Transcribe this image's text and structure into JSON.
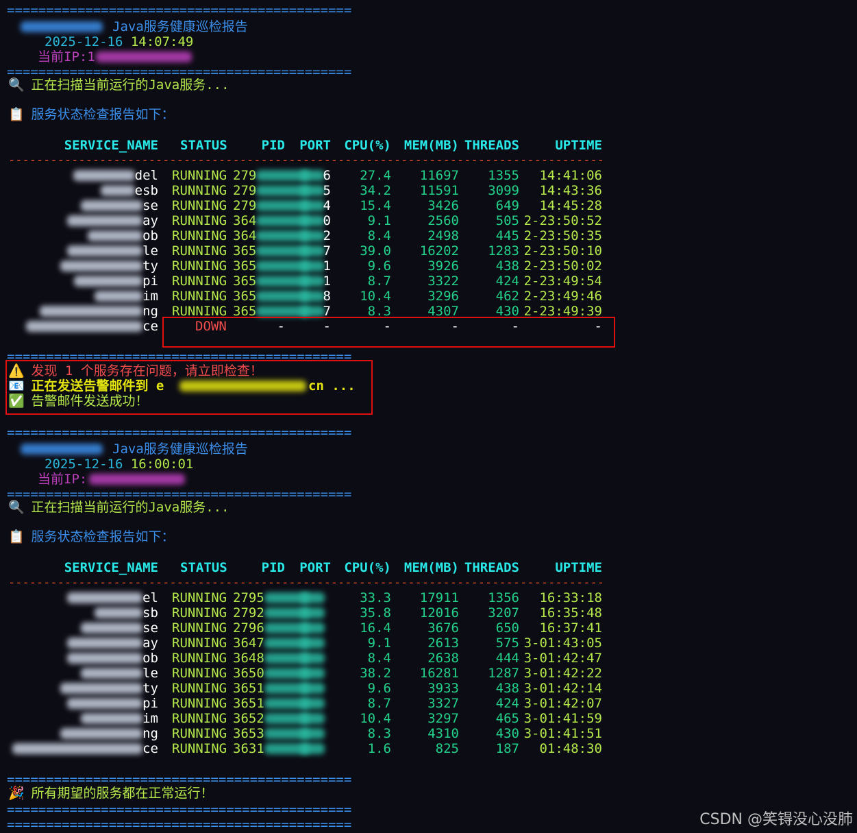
{
  "separator": "============================================",
  "dashes": "-------------------------------------------------------------------------------------------------",
  "report1": {
    "title": "Java服务健康巡检报告",
    "datetime_date": "2025-12-16",
    "datetime_time": "14:07:49",
    "ip_label": "当前IP:",
    "ip_prefix": "1",
    "scanning": "正在扫描当前运行的Java服务...",
    "report_heading": "服务状态检查报告如下：",
    "headers": [
      "SERVICE_NAME",
      "STATUS",
      "PID",
      "PORT",
      "CPU(%)",
      "MEM(MB)",
      "THREADS",
      "UPTIME"
    ],
    "rows": [
      {
        "name_tail": "del",
        "status": "RUNNING",
        "pid_head": "279",
        "port_tail": "6",
        "cpu": "27.4",
        "mem": "11697",
        "threads": "1355",
        "uptime": "14:41:06"
      },
      {
        "name_tail": "esb",
        "status": "RUNNING",
        "pid_head": "279",
        "port_tail": "5",
        "cpu": "34.2",
        "mem": "11591",
        "threads": "3099",
        "uptime": "14:43:36"
      },
      {
        "name_tail": "se",
        "status": "RUNNING",
        "pid_head": "279",
        "port_tail": "4",
        "cpu": "15.4",
        "mem": "3426",
        "threads": "649",
        "uptime": "14:45:28"
      },
      {
        "name_tail": "ay",
        "status": "RUNNING",
        "pid_head": "364",
        "port_tail": "0",
        "cpu": "9.1",
        "mem": "2560",
        "threads": "505",
        "uptime": "2-23:50:52"
      },
      {
        "name_tail": "ob",
        "status": "RUNNING",
        "pid_head": "364",
        "port_tail": "2",
        "cpu": "8.4",
        "mem": "2498",
        "threads": "445",
        "uptime": "2-23:50:35"
      },
      {
        "name_tail": "le",
        "status": "RUNNING",
        "pid_head": "365",
        "port_tail": "7",
        "cpu": "39.0",
        "mem": "16202",
        "threads": "1283",
        "uptime": "2-23:50:10"
      },
      {
        "name_tail": "ty",
        "status": "RUNNING",
        "pid_head": "365",
        "port_tail": "1",
        "cpu": "9.6",
        "mem": "3926",
        "threads": "438",
        "uptime": "2-23:50:02"
      },
      {
        "name_tail": "pi",
        "status": "RUNNING",
        "pid_head": "365",
        "port_tail": "1",
        "cpu": "8.7",
        "mem": "3322",
        "threads": "424",
        "uptime": "2-23:49:54"
      },
      {
        "name_tail": "im",
        "status": "RUNNING",
        "pid_head": "365",
        "port_tail": "8",
        "cpu": "10.4",
        "mem": "3296",
        "threads": "462",
        "uptime": "2-23:49:46"
      },
      {
        "name_tail": "ng",
        "status": "RUNNING",
        "pid_head": "365",
        "port_tail": "7",
        "cpu": "8.3",
        "mem": "4307",
        "threads": "430",
        "uptime": "2-23:49:39"
      }
    ],
    "down_row": {
      "name_tail": "ce",
      "status": "DOWN",
      "pid": "-",
      "port": "-",
      "cpu": "-",
      "mem": "-",
      "threads": "-",
      "uptime": "-"
    },
    "alert_found": "发现 1 个服务存在问题，请立即检查！",
    "alert_sending_prefix": "正在发送告警邮件到",
    "alert_email_head": "e",
    "alert_email_tail": "cn ...",
    "alert_sent": "告警邮件发送成功！"
  },
  "report2": {
    "title": "Java服务健康巡检报告",
    "datetime_date": "2025-12-16",
    "datetime_time": "16:00:01",
    "ip_label": "当前IP:",
    "scanning": "正在扫描当前运行的Java服务...",
    "report_heading": "服务状态检查报告如下：",
    "headers": [
      "SERVICE_NAME",
      "STATUS",
      "PID",
      "PORT",
      "CPU(%)",
      "MEM(MB)",
      "THREADS",
      "UPTIME"
    ],
    "rows": [
      {
        "name_tail": "el",
        "status": "RUNNING",
        "pid_head": "2795",
        "cpu": "33.3",
        "mem": "17911",
        "threads": "1356",
        "uptime": "16:33:18"
      },
      {
        "name_tail": "sb",
        "status": "RUNNING",
        "pid_head": "2792",
        "cpu": "35.8",
        "mem": "12016",
        "threads": "3207",
        "uptime": "16:35:48"
      },
      {
        "name_tail": "se",
        "status": "RUNNING",
        "pid_head": "2796",
        "cpu": "16.4",
        "mem": "3676",
        "threads": "650",
        "uptime": "16:37:41"
      },
      {
        "name_tail": "ay",
        "status": "RUNNING",
        "pid_head": "3647",
        "cpu": "9.1",
        "mem": "2613",
        "threads": "575",
        "uptime": "3-01:43:05"
      },
      {
        "name_tail": "ob",
        "status": "RUNNING",
        "pid_head": "3648",
        "cpu": "8.4",
        "mem": "2638",
        "threads": "444",
        "uptime": "3-01:42:47"
      },
      {
        "name_tail": "le",
        "status": "RUNNING",
        "pid_head": "3650",
        "cpu": "38.2",
        "mem": "16281",
        "threads": "1287",
        "uptime": "3-01:42:22"
      },
      {
        "name_tail": "ty",
        "status": "RUNNING",
        "pid_head": "3651",
        "cpu": "9.6",
        "mem": "3933",
        "threads": "438",
        "uptime": "3-01:42:14"
      },
      {
        "name_tail": "pi",
        "status": "RUNNING",
        "pid_head": "3651",
        "cpu": "8.7",
        "mem": "3327",
        "threads": "424",
        "uptime": "3-01:42:07"
      },
      {
        "name_tail": "im",
        "status": "RUNNING",
        "pid_head": "3652",
        "cpu": "10.4",
        "mem": "3297",
        "threads": "465",
        "uptime": "3-01:41:59"
      },
      {
        "name_tail": "ng",
        "status": "RUNNING",
        "pid_head": "3653",
        "cpu": "8.3",
        "mem": "4310",
        "threads": "430",
        "uptime": "3-01:41:51"
      },
      {
        "name_tail": "ce",
        "status": "RUNNING",
        "pid_head": "3631",
        "cpu": "1.6",
        "mem": "825",
        "threads": "187",
        "uptime": "01:48:30"
      }
    ],
    "all_ok": "所有期望的服务都在正常运行！"
  },
  "watermark": "CSDN @笑锝没心没肺",
  "icons": {
    "scan": "magnifier-icon",
    "report": "clipboard-icon",
    "warning": "warning-icon",
    "mail": "envelope-icon",
    "check": "check-icon",
    "party": "party-popper-icon"
  },
  "colors": {
    "background": "#0c0c14",
    "separator": "#3b8eea",
    "running": "#b5e84a",
    "down": "#f14c4c",
    "header": "#29e8e8",
    "highlight_box": "#e01010"
  }
}
